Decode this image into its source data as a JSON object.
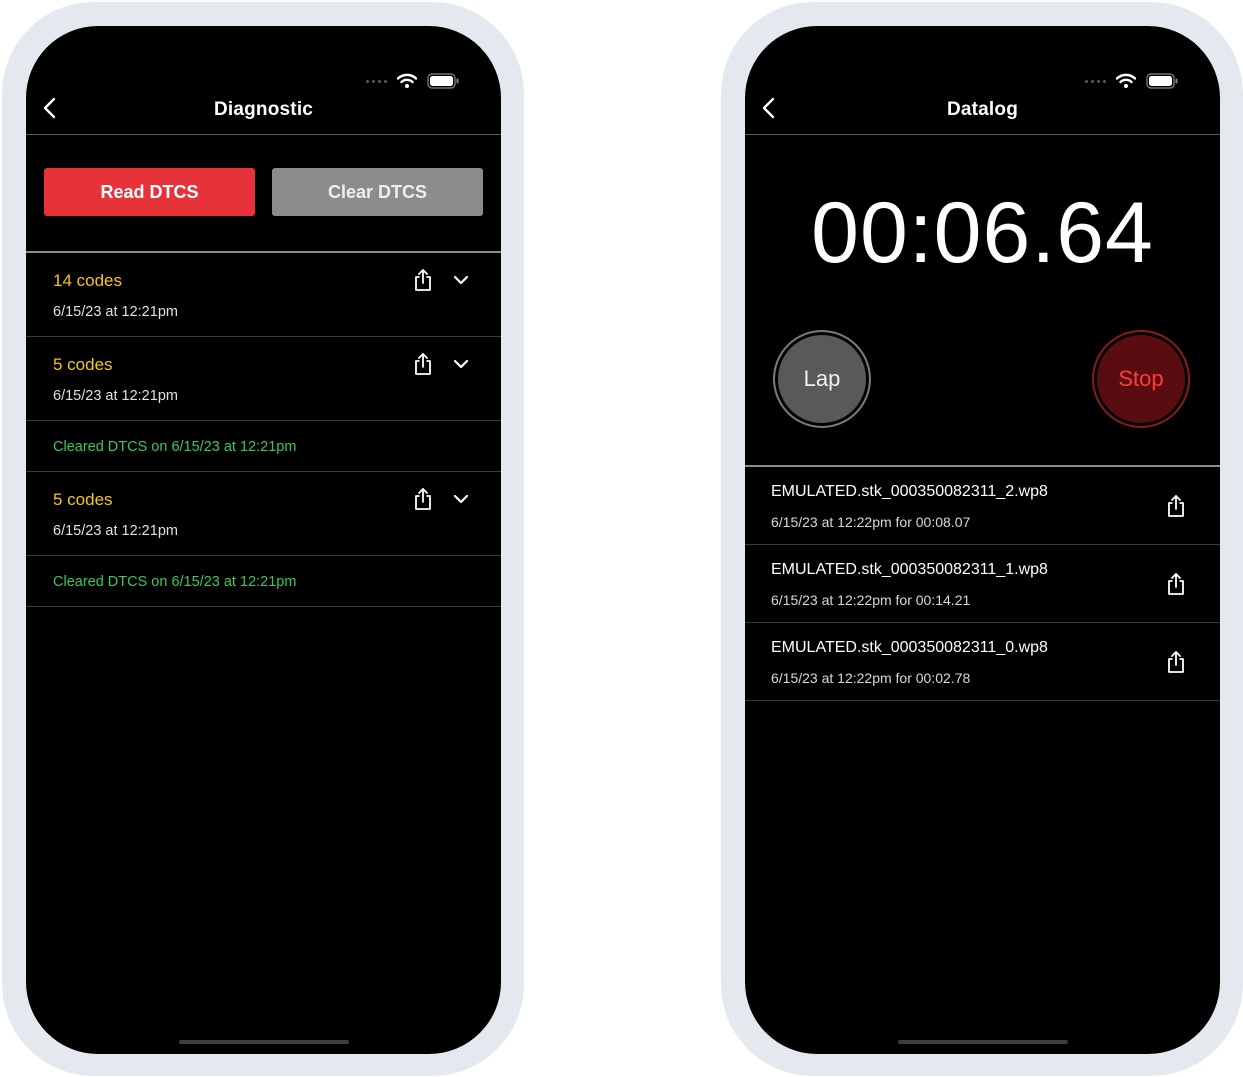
{
  "diagnostic_screen": {
    "title": "Diagnostic",
    "read_button": "Read DTCS",
    "clear_button": "Clear DTCS",
    "entries": [
      {
        "type": "codes",
        "title": "14 codes",
        "timestamp": "6/15/23 at 12:21pm"
      },
      {
        "type": "codes",
        "title": "5 codes",
        "timestamp": "6/15/23 at 12:21pm"
      },
      {
        "type": "cleared",
        "text": "Cleared DTCS on 6/15/23 at 12:21pm"
      },
      {
        "type": "codes",
        "title": "5 codes",
        "timestamp": "6/15/23 at 12:21pm"
      },
      {
        "type": "cleared",
        "text": "Cleared DTCS on 6/15/23 at 12:21pm"
      }
    ]
  },
  "datalog_screen": {
    "title": "Datalog",
    "timer": "00:06.64",
    "lap_button": "Lap",
    "stop_button": "Stop",
    "logs": [
      {
        "filename": "EMULATED.stk_000350082311_2.wp8",
        "detail": "6/15/23 at 12:22pm for 00:08.07"
      },
      {
        "filename": "EMULATED.stk_000350082311_1.wp8",
        "detail": "6/15/23 at 12:22pm for 00:14.21"
      },
      {
        "filename": "EMULATED.stk_000350082311_0.wp8",
        "detail": "6/15/23 at 12:22pm for 00:02.78"
      }
    ]
  },
  "colors": {
    "read_button": "#e8323a",
    "clear_button": "#8c8c8c",
    "codes_text": "#f5c518",
    "cleared_text": "#39c95a",
    "stop_button_text": "#ff3b3b",
    "background": "#000000"
  },
  "icons": [
    "back-icon",
    "share-icon",
    "chevron-down-icon",
    "wifi-icon",
    "battery-icon",
    "signal-icon"
  ]
}
